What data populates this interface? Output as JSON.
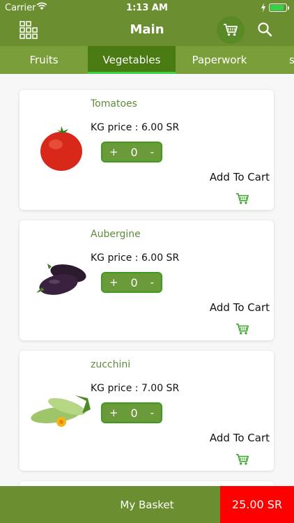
{
  "status": {
    "carrier": "Carrier",
    "time": "1:13 AM"
  },
  "header": {
    "title": "Main",
    "icons": [
      "grid-menu-icon",
      "cart-icon",
      "search-icon"
    ]
  },
  "tabs": [
    {
      "label": "Fruits"
    },
    {
      "label": "Vegetables",
      "active": true
    },
    {
      "label": "Paperwork"
    },
    {
      "label": "s"
    }
  ],
  "products": [
    {
      "name": "Tomatoes",
      "price": "KG price : 6.00 SR",
      "plus": "+",
      "qty": "0",
      "minus": "-",
      "add_label": "Add To Cart"
    },
    {
      "name": "Aubergine",
      "price": "KG price : 6.00 SR",
      "plus": "+",
      "qty": "0",
      "minus": "-",
      "add_label": "Add To Cart"
    },
    {
      "name": "zucchini",
      "price": "KG price : 7.00 SR",
      "plus": "+",
      "qty": "0",
      "minus": "-",
      "add_label": "Add To Cart"
    }
  ],
  "footer": {
    "basket_label": "My Basket",
    "total": "25.00 SR"
  },
  "colors": {
    "header": "#6b8f30",
    "tab_bar": "#7a9e3a",
    "active_tab": "#4a7a12",
    "accent": "#6b9a3a",
    "total_bg": "#ff0000"
  }
}
